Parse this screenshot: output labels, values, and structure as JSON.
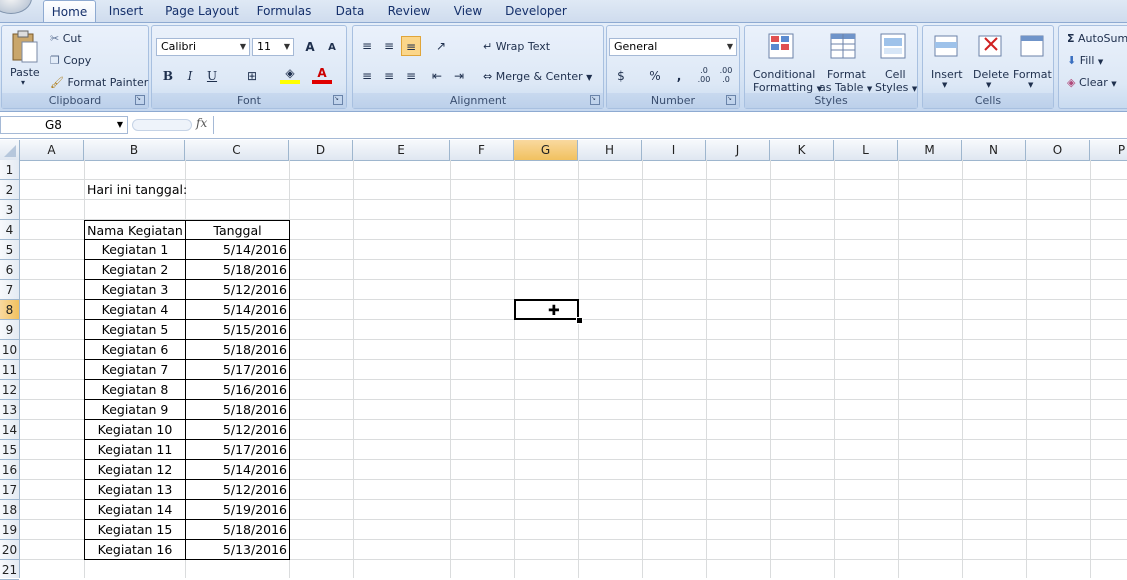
{
  "tabs": [
    "Home",
    "Insert",
    "Page Layout",
    "Formulas",
    "Data",
    "Review",
    "View",
    "Developer"
  ],
  "clipboard": {
    "paste": "Paste",
    "cut": "Cut",
    "copy": "Copy",
    "format_painter": "Format Painter",
    "label": "Clipboard"
  },
  "font": {
    "name": "Calibri",
    "size": "11",
    "bold": "B",
    "italic": "I",
    "underline": "U",
    "label": "Font",
    "grow": "A",
    "shrink": "A"
  },
  "alignment": {
    "wrap_text": "Wrap Text",
    "merge_center": "Merge & Center",
    "label": "Alignment"
  },
  "number": {
    "format": "General",
    "currency": "$",
    "percent": "%",
    "comma": ",",
    "inc_decimal": ".0 .00",
    "dec_decimal": ".00 .0",
    "label": "Number"
  },
  "styles": {
    "conditional": "Conditional",
    "conditional2": "Formatting",
    "format_table": "Format",
    "format_table2": "as Table",
    "cell_styles": "Cell",
    "cell_styles2": "Styles",
    "label": "Styles"
  },
  "cells_group": {
    "insert": "Insert",
    "delete": "Delete",
    "format": "Format",
    "label": "Cells"
  },
  "editing": {
    "autosum": "AutoSum",
    "fill": "Fill",
    "clear": "Clear",
    "sigma": "Σ"
  },
  "namebox": "G8",
  "fx": "fx",
  "columns": [
    "A",
    "B",
    "C",
    "D",
    "E",
    "F",
    "G",
    "H",
    "I",
    "J",
    "K",
    "L",
    "M",
    "N",
    "O",
    "P"
  ],
  "selected_column": "G",
  "rows": [
    "1",
    "2",
    "3",
    "4",
    "5",
    "6",
    "7",
    "8",
    "9",
    "10",
    "11",
    "12",
    "13",
    "14",
    "15",
    "16",
    "17",
    "18",
    "19",
    "20",
    "21"
  ],
  "selected_row": "8",
  "sheet": {
    "b2": "Hari ini tanggal:",
    "header_nama": "Nama Kegiatan",
    "header_tanggal": "Tanggal",
    "records": [
      {
        "nama": "Kegiatan 1",
        "tanggal": "5/14/2016"
      },
      {
        "nama": "Kegiatan 2",
        "tanggal": "5/18/2016"
      },
      {
        "nama": "Kegiatan 3",
        "tanggal": "5/12/2016"
      },
      {
        "nama": "Kegiatan 4",
        "tanggal": "5/14/2016"
      },
      {
        "nama": "Kegiatan 5",
        "tanggal": "5/15/2016"
      },
      {
        "nama": "Kegiatan 6",
        "tanggal": "5/18/2016"
      },
      {
        "nama": "Kegiatan 7",
        "tanggal": "5/17/2016"
      },
      {
        "nama": "Kegiatan 8",
        "tanggal": "5/16/2016"
      },
      {
        "nama": "Kegiatan 9",
        "tanggal": "5/18/2016"
      },
      {
        "nama": "Kegiatan 10",
        "tanggal": "5/12/2016"
      },
      {
        "nama": "Kegiatan 11",
        "tanggal": "5/17/2016"
      },
      {
        "nama": "Kegiatan 12",
        "tanggal": "5/14/2016"
      },
      {
        "nama": "Kegiatan 13",
        "tanggal": "5/12/2016"
      },
      {
        "nama": "Kegiatan 14",
        "tanggal": "5/19/2016"
      },
      {
        "nama": "Kegiatan 15",
        "tanggal": "5/18/2016"
      },
      {
        "nama": "Kegiatan 16",
        "tanggal": "5/13/2016"
      }
    ]
  },
  "colors": {
    "selected_header": "#f1c15f",
    "ribbon": "#dde8f6",
    "grid": "#dadcdd"
  }
}
